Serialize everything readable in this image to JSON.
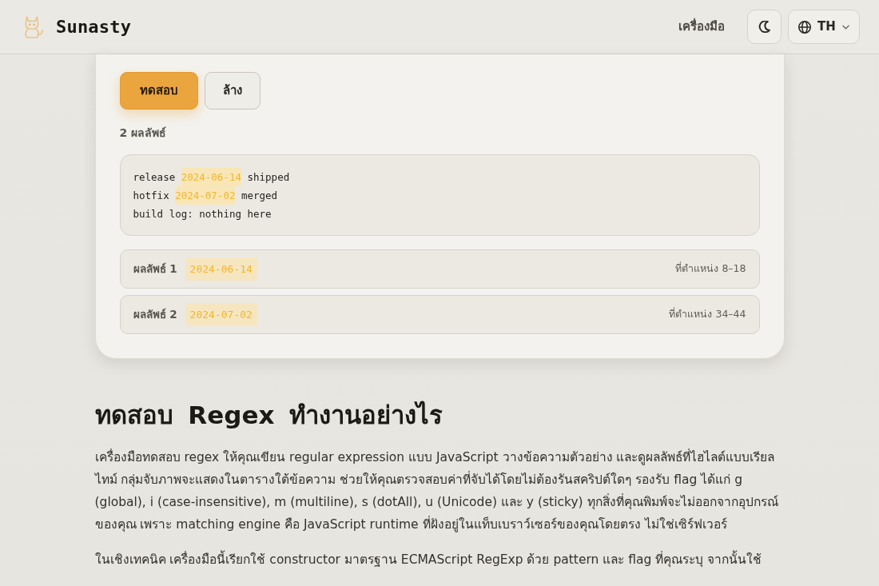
{
  "header": {
    "brand": "Sunasty",
    "nav_link": "เครื่องมือ",
    "language": "TH"
  },
  "tester": {
    "buttons": [
      {
        "label": "ทดสอบ",
        "kind": "primary"
      },
      {
        "label": "ล้าง",
        "kind": "outline"
      }
    ],
    "match_count": "2 ผลลัพธ์",
    "preview_lines": [
      {
        "segments": [
          {
            "text": "release ",
            "highlighted": false
          },
          {
            "text": "2024-06-14",
            "highlighted": true
          },
          {
            "text": " shipped",
            "highlighted": false
          }
        ]
      },
      {
        "segments": [
          {
            "text": "hotfix ",
            "highlighted": false
          },
          {
            "text": "2024-07-02",
            "highlighted": true
          },
          {
            "text": " merged",
            "highlighted": false
          }
        ]
      },
      {
        "segments": [
          {
            "text": "build log: nothing here",
            "highlighted": false
          }
        ]
      }
    ],
    "matches": [
      {
        "label": "ผลลัพธ์ 1",
        "value": "2024-06-14",
        "position": "ที่ตำแหน่ง 8–18"
      },
      {
        "label": "ผลลัพธ์ 2",
        "value": "2024-07-02",
        "position": "ที่ตำแหน่ง 34–44"
      }
    ]
  },
  "article": {
    "heading": "ทดสอบ Regex ทำงานอย่างไร",
    "paragraphs": [
      "เครื่องมือทดสอบ regex ให้คุณเขียน regular expression แบบ JavaScript วางข้อความตัวอย่าง และดูผลลัพธ์ที่ไฮไลต์แบบเรียลไทม์ กลุ่มจับภาพจะแสดงในตารางใต้ข้อความ ช่วยให้คุณตรวจสอบค่าที่จับได้โดยไม่ต้องรันสคริปต์ใดๆ รองรับ flag ได้แก่ g (global), i (case-insensitive), m (multiline), s (dotAll), u (Unicode) และ y (sticky) ทุกสิ่งที่คุณพิมพ์จะไม่ออกจากอุปกรณ์ของคุณ เพราะ matching engine คือ JavaScript runtime ที่ฝังอยู่ในแท็บเบราว์เซอร์ของคุณโดยตรง ไม่ใช่เซิร์ฟเวอร์",
      "ในเชิงเทคนิค เครื่องมือนี้เรียกใช้ constructor มาตรฐาน ECMAScript RegExp ด้วย pattern และ flag ที่คุณระบุ จากนั้นใช้"
    ]
  }
}
